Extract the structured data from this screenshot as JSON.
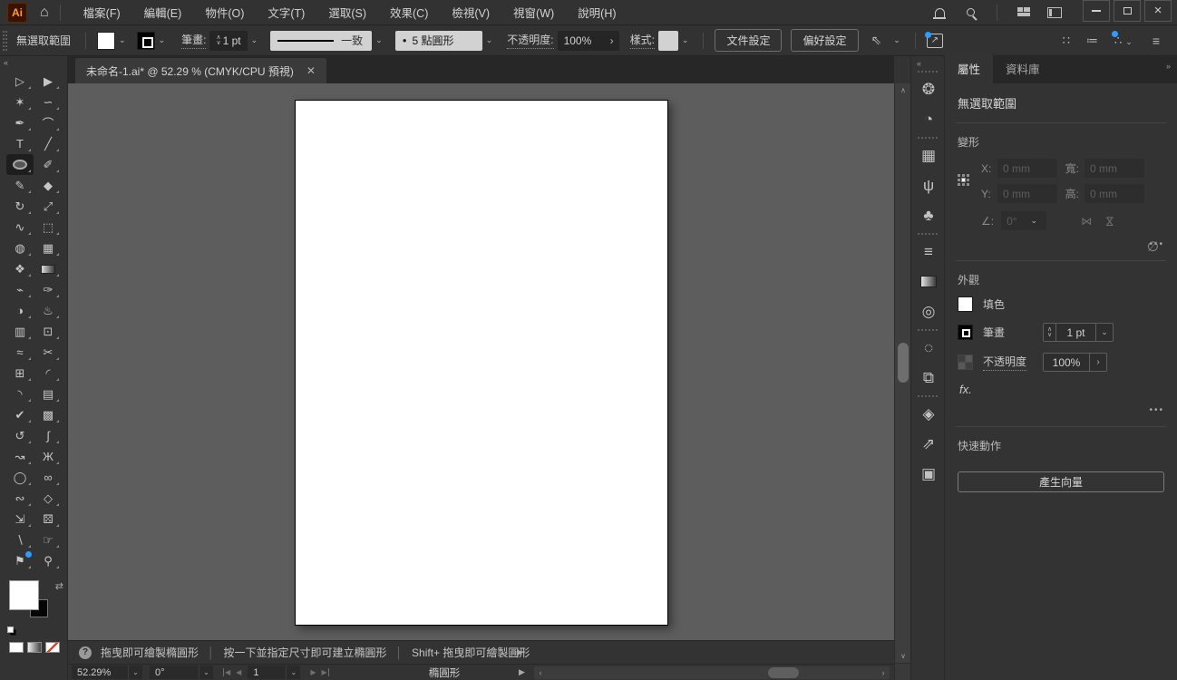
{
  "app": {
    "logo_text": "Ai",
    "accent": "#2d9bff"
  },
  "icons": {
    "home": "⌂",
    "chevron_down": "⌄",
    "chevron_right": "›",
    "chevron_left": "‹",
    "scroll_up": "∧",
    "scroll_down": "∨",
    "collapse_left": "«",
    "collapse_right": "»",
    "more": "•••",
    "menu": "≡",
    "grid_dim": "∷",
    "arrange": "≔",
    "snap": "∴",
    "close": "×",
    "minimize": "—",
    "tab_close": "✕",
    "nav_first": "◀",
    "nav_prev": "◀",
    "nav_next": "▶",
    "nav_last": "▶",
    "expander": "▶",
    "swap": "⇄",
    "share_arrow": "↗",
    "cursor_menu": "⇖",
    "step_up": "∧",
    "step_down": "∨",
    "angle": "∠:",
    "flip": "⋈",
    "link": "∅",
    "help": "?",
    "brush_dot": "●",
    "arrow_more": "›"
  },
  "menubar": {
    "items": [
      "檔案(F)",
      "編輯(E)",
      "物件(O)",
      "文字(T)",
      "選取(S)",
      "效果(C)",
      "檢視(V)",
      "視窗(W)",
      "說明(H)"
    ]
  },
  "controlbar": {
    "no_selection": "無選取範圍",
    "stroke_label": "筆畫:",
    "stroke_weight": "1 pt",
    "stroke_profile": "一致",
    "brush_name": "5 點圓形",
    "opacity_label": "不透明度:",
    "opacity_value": "100%",
    "style_label": "樣式:",
    "doc_setup_button": "文件設定",
    "preferences_button": "偏好設定"
  },
  "tabbar": {
    "title": "未命名-1.ai* @ 52.29 % (CMYK/CPU 預視)"
  },
  "toolbar": {
    "tools": [
      {
        "n": "selection-tool",
        "g": "▷"
      },
      {
        "n": "direct-selection-tool",
        "g": "▶"
      },
      {
        "n": "magic-wand-tool",
        "g": "✶"
      },
      {
        "n": "lasso-tool",
        "g": "∽"
      },
      {
        "n": "pen-tool",
        "g": "✒"
      },
      {
        "n": "curvature-tool",
        "g": "⌒"
      },
      {
        "n": "type-tool",
        "g": "T"
      },
      {
        "n": "line-segment-tool",
        "g": "╱"
      },
      {
        "n": "ellipse-tool",
        "type": "ellipse",
        "sel": true
      },
      {
        "n": "paintbrush-tool",
        "g": "✐"
      },
      {
        "n": "shaper-tool",
        "g": "✎"
      },
      {
        "n": "eraser-tool",
        "g": "◆"
      },
      {
        "n": "rotate-tool",
        "g": "↻"
      },
      {
        "n": "scale-tool",
        "g": "⤢"
      },
      {
        "n": "width-tool",
        "g": "∿"
      },
      {
        "n": "free-transform-tool",
        "g": "⬚"
      },
      {
        "n": "shape-builder-tool",
        "g": "◍"
      },
      {
        "n": "perspective-grid-tool",
        "g": "▦"
      },
      {
        "n": "mesh-tool",
        "g": "❖"
      },
      {
        "n": "gradient-tool",
        "type": "gradient"
      },
      {
        "n": "knife-tool",
        "g": "⌁"
      },
      {
        "n": "eyedropper-tool",
        "g": "✑"
      },
      {
        "n": "blend-tool",
        "g": "◑"
      },
      {
        "n": "symbol-sprayer-tool",
        "g": "♨"
      },
      {
        "n": "column-graph-tool",
        "g": "▥"
      },
      {
        "n": "artboard-tool",
        "g": "⊡"
      },
      {
        "n": "smooth-tool",
        "g": "≈"
      },
      {
        "n": "scissors-tool",
        "g": "✂"
      },
      {
        "n": "live-paint-bucket-tool",
        "g": "⊞"
      },
      {
        "n": "corner-widget-tool",
        "g": "◜"
      },
      {
        "n": "anchor-point-tool",
        "g": "◝"
      },
      {
        "n": "measure-tool",
        "g": "▤"
      },
      {
        "n": "checkmark-brush-tool",
        "g": "✔"
      },
      {
        "n": "texture-tool",
        "g": "▩"
      },
      {
        "n": "rotate-view-tool",
        "g": "↺"
      },
      {
        "n": "pencil-curve-tool",
        "g": "∫"
      },
      {
        "n": "path-select-tool",
        "g": "↝"
      },
      {
        "n": "butterfly-tool",
        "g": "Ж"
      },
      {
        "n": "blob-brush-tool",
        "g": "◯"
      },
      {
        "n": "binoculars-tool",
        "g": "∞"
      },
      {
        "n": "wave-tool",
        "g": "∾"
      },
      {
        "n": "diamond-graph-tool",
        "g": "◇"
      },
      {
        "n": "pencil-arrow-tool",
        "g": "⇲"
      },
      {
        "n": "dice-tool",
        "g": "⚄"
      },
      {
        "n": "blade-tool",
        "g": "∖"
      },
      {
        "n": "hand-tool",
        "g": "☞"
      },
      {
        "n": "flag-tool",
        "g": "⚑",
        "dot": true
      },
      {
        "n": "zoom-tool",
        "g": "⚲"
      }
    ]
  },
  "dock": {
    "groups": [
      [
        {
          "n": "color-panel-icon",
          "g": "❂"
        },
        {
          "n": "color-guide-panel-icon",
          "g": "◔"
        }
      ],
      [
        {
          "n": "swatches-panel-icon",
          "g": "▦"
        },
        {
          "n": "brushes-panel-icon",
          "g": "ψ"
        },
        {
          "n": "symbols-panel-icon",
          "g": "♣"
        }
      ],
      [
        {
          "n": "stroke-panel-icon",
          "g": "≡"
        },
        {
          "n": "gradient-panel-icon",
          "type": "gradient"
        },
        {
          "n": "transparency-panel-icon",
          "g": "◎"
        }
      ],
      [
        {
          "n": "dotted-circle-panel-icon",
          "g": "◌"
        },
        {
          "n": "pathfinder-panel-icon",
          "g": "⧉"
        }
      ],
      [
        {
          "n": "layers-panel-icon",
          "g": "◈"
        },
        {
          "n": "export-panel-icon",
          "g": "⇗"
        },
        {
          "n": "artboards-panel-icon",
          "g": "▣"
        }
      ]
    ]
  },
  "panel": {
    "tab_properties": "屬性",
    "tab_libraries": "資料庫",
    "no_selection": "無選取範圍",
    "transform": {
      "title": "變形",
      "x_label": "X:",
      "x_value": "0 mm",
      "y_label": "Y:",
      "y_value": "0 mm",
      "w_label": "寬:",
      "w_value": "0 mm",
      "h_label": "高:",
      "h_value": "0 mm",
      "angle_value": "0°"
    },
    "appearance": {
      "title": "外觀",
      "fill_label": "填色",
      "stroke_label": "筆畫",
      "stroke_weight": "1 pt",
      "opacity_label": "不透明度",
      "opacity_value": "100%",
      "fx_label": "fx."
    },
    "quick_actions": {
      "title": "快速動作",
      "generate_button": "產生向量"
    }
  },
  "hints": {
    "separator": "│",
    "items": [
      "拖曳即可繪製橢圓形",
      "按一下並指定尺寸即可建立橢圓形",
      "Shift+ 拖曳即可繪製圓形"
    ]
  },
  "statusbar": {
    "zoom": "52.29%",
    "rotation": "0°",
    "artboard_number": "1",
    "tool_name": "橢圓形"
  }
}
